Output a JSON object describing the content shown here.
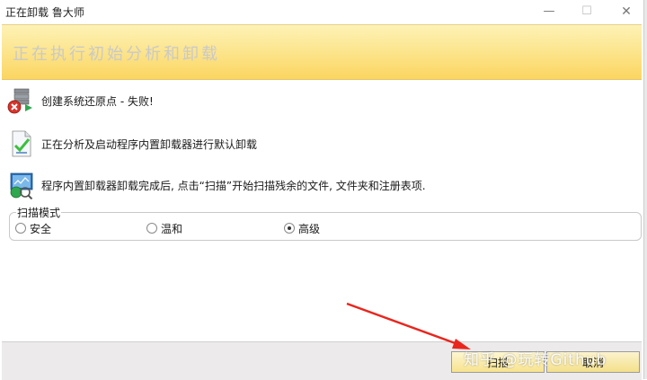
{
  "window": {
    "title": "正在卸载 鲁大师",
    "minimize": "—",
    "maximize": "☐",
    "close": "✕"
  },
  "banner": {
    "heading": "正在执行初始分析和卸载"
  },
  "steps": [
    {
      "text": "创建系统还原点 - 失败!",
      "icon": "restore-point-failed-icon"
    },
    {
      "text": "正在分析及启动程序内置卸载器进行默认卸载",
      "icon": "document-check-icon"
    },
    {
      "text": "程序内置卸载器卸载完成后, 点击“扫描”开始扫描残余的文件, 文件夹和注册表项.",
      "icon": "scan-monitor-icon"
    }
  ],
  "scan_mode": {
    "legend": "扫描模式",
    "options": [
      {
        "label": "安全",
        "checked": false
      },
      {
        "label": "温和",
        "checked": false
      },
      {
        "label": "高级",
        "checked": true
      }
    ]
  },
  "footer": {
    "scan_label": "扫描",
    "cancel_label": "取消"
  },
  "overlay": {
    "watermark": "知乎 @玩转Github",
    "arrow_color": "#e8261e"
  },
  "colors": {
    "banner_top": "#fdf2b6",
    "banner_bottom": "#fbd560",
    "heading_text": "#c9c9c9",
    "button_fill": "#f7e38d"
  }
}
